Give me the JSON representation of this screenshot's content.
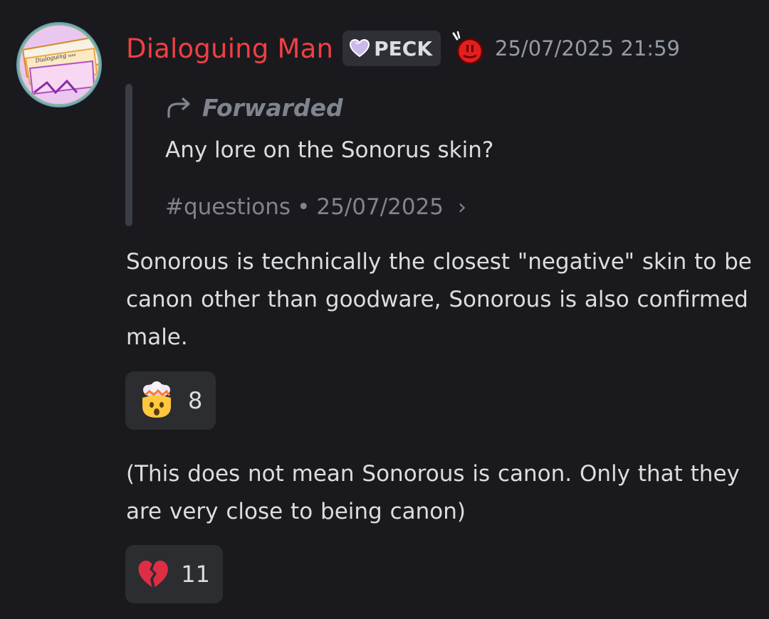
{
  "message": {
    "author": {
      "name": "Dialoguing Man",
      "name_color": "#f23f43",
      "avatar_icon": "avatar-image",
      "tag": {
        "icon": "heart-icon",
        "label": "PECK"
      },
      "role_icon": "red-angry-face-icon"
    },
    "timestamp": "25/07/2025 21:59",
    "forwarded": {
      "label": "Forwarded",
      "icon": "forward-arrow-icon",
      "text": "Any lore on the Sonorus skin?",
      "channel": "#questions",
      "separator": "•",
      "date": "25/07/2025",
      "chevron": "›"
    },
    "content": [
      {
        "text": "Sonorous is technically the closest \"negative\" skin to be canon other than goodware, Sonorous is also confirmed male.",
        "reaction": {
          "emoji": "exploding-head-emoji",
          "count": "8"
        }
      },
      {
        "text": "(This does not mean Sonorous is canon. Only that they are very close to being canon)",
        "reaction": {
          "emoji": "broken-heart-emoji",
          "count": "11"
        }
      }
    ]
  },
  "colors": {
    "background": "#1a1a1e",
    "text": "#dbdee1",
    "muted": "#949ba4",
    "reaction_bg": "#2b2d31"
  }
}
